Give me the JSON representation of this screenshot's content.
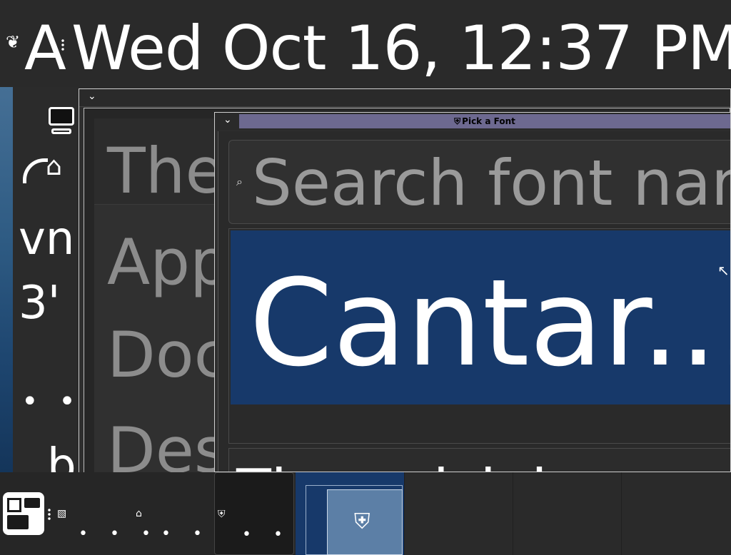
{
  "top_panel": {
    "activities_icon": "gnome-foot-icon",
    "left_text": "A",
    "clock": "Wed Oct 16, 12:37 PM"
  },
  "desktop": {
    "text_vn": "vn",
    "text_3": "3'",
    "text_dots": "• • •",
    "text_b": "b"
  },
  "back_window": {
    "search_text": "The",
    "items": [
      "App",
      "Doc",
      "Des"
    ]
  },
  "dialog": {
    "title": "Pick a Font",
    "title_icon": "shield-icon",
    "search_placeholder": "Search font nam",
    "selected_font_label": "Cantar...",
    "preview_text": "The quick br"
  },
  "dock": {
    "item_dots": [
      "• • •",
      "• • •",
      "• • •"
    ],
    "icons": [
      "image-viewer-icon",
      "home-icon",
      "shield-icon",
      "shield-icon"
    ]
  }
}
